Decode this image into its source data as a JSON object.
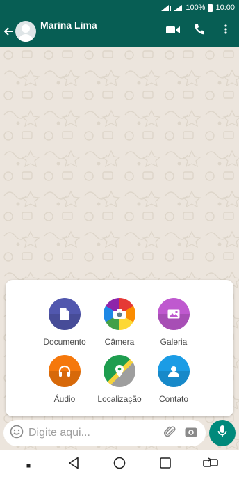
{
  "status_bar": {
    "battery": "100%",
    "time": "10:00"
  },
  "header": {
    "contact_name": "Marina Lima"
  },
  "attachments": [
    {
      "label": "Documento",
      "icon": "document-icon",
      "color": "#5157ae"
    },
    {
      "label": "Câmera",
      "icon": "camera-icon",
      "color": "#d3396d"
    },
    {
      "label": "Galeria",
      "icon": "gallery-icon",
      "color": "#bf59cf"
    },
    {
      "label": "Áudio",
      "icon": "headphones-icon",
      "color": "#f96533"
    },
    {
      "label": "Localização",
      "icon": "location-icon",
      "color": "#1fa855"
    },
    {
      "label": "Contato",
      "icon": "contact-icon",
      "color": "#0ea5e9"
    }
  ],
  "composer": {
    "placeholder": "Digite aqui..."
  },
  "colors": {
    "app_bar": "#075e54",
    "mic_button": "#00897b",
    "chat_background": "#ece5dd"
  }
}
